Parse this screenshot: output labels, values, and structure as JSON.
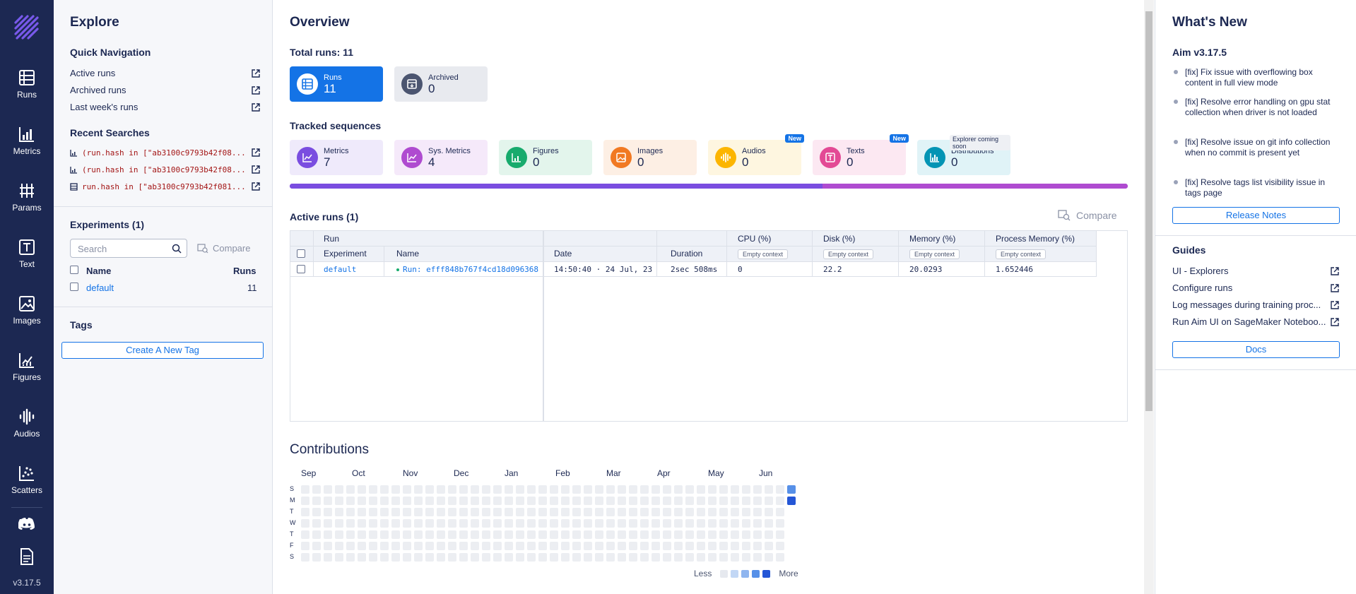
{
  "nav": {
    "items": [
      {
        "label": "Runs"
      },
      {
        "label": "Metrics"
      },
      {
        "label": "Params"
      },
      {
        "label": "Text"
      },
      {
        "label": "Images"
      },
      {
        "label": "Figures"
      },
      {
        "label": "Audios"
      },
      {
        "label": "Scatters"
      }
    ],
    "version": "v3.17.5"
  },
  "explore": {
    "title": "Explore",
    "quick_nav_title": "Quick Navigation",
    "quick_nav": [
      "Active runs",
      "Archived runs",
      "Last week's runs"
    ],
    "recent_title": "Recent Searches",
    "recent": [
      "(run.hash in [\"ab3100c9793b42f08...",
      "(run.hash in [\"ab3100c9793b42f08...",
      "run.hash in [\"ab3100c9793b42f081..."
    ],
    "experiments_title": "Experiments (1)",
    "search_placeholder": "Search",
    "compare": "Compare",
    "col_name": "Name",
    "col_runs": "Runs",
    "exp_name": "default",
    "exp_runs": "11",
    "tags_title": "Tags",
    "create_tag": "Create A New Tag"
  },
  "main": {
    "title": "Overview",
    "total_runs": "Total runs: 11",
    "run_cards": [
      {
        "label": "Runs",
        "value": "11"
      },
      {
        "label": "Archived",
        "value": "0"
      }
    ],
    "tracked_title": "Tracked sequences",
    "seq_cards": [
      {
        "label": "Metrics",
        "value": "7",
        "color": "#7a4de0"
      },
      {
        "label": "Sys. Metrics",
        "value": "4",
        "color": "#af4bd0"
      },
      {
        "label": "Figures",
        "value": "0",
        "color": "#18ab6d"
      },
      {
        "label": "Images",
        "value": "0",
        "color": "#f17922"
      },
      {
        "label": "Audios",
        "value": "0",
        "color": "#fcb500",
        "badge": "New"
      },
      {
        "label": "Texts",
        "value": "0",
        "color": "#e34a95",
        "badge": "New"
      },
      {
        "label": "Distributions",
        "value": "0",
        "color": "#0394b4",
        "badge": "Explorer coming soon"
      }
    ],
    "progress": {
      "metrics_fraction": 0.636,
      "metrics_color": "#7a4de0",
      "sys_color": "#af4bd0"
    },
    "active_runs_title": "Active runs (1)",
    "compare": "Compare",
    "table": {
      "group_run": "Run",
      "col_experiment": "Experiment",
      "col_name": "Name",
      "col_date": "Date",
      "col_duration": "Duration",
      "col_cpu": "CPU (%)",
      "col_disk": "Disk (%)",
      "col_memory": "Memory (%)",
      "col_pmem": "Process Memory (%)",
      "empty_context": "Empty context",
      "row": {
        "experiment": "default",
        "name": "Run: efff848b767f4cd18d096368",
        "date": "14:50:40 · 24 Jul, 23",
        "duration": "2sec 508ms",
        "cpu": "0",
        "disk": "22.2",
        "memory": "20.0293",
        "pmem": "1.652446"
      }
    },
    "contributions_title": "Contributions",
    "months": [
      "Sep",
      "Oct",
      "Nov",
      "Dec",
      "Jan",
      "Feb",
      "Mar",
      "Apr",
      "May",
      "Jun"
    ],
    "days": [
      "S",
      "M",
      "T",
      "W",
      "T",
      "F",
      "S"
    ],
    "legend_less": "Less",
    "legend_more": "More",
    "legend_colors": [
      "#e6e9ef",
      "#c2d7f5",
      "#8fb5ef",
      "#5790e8",
      "#2456d6"
    ]
  },
  "whats_new": {
    "title": "What's New",
    "version": "Aim v3.17.5",
    "items": [
      "[fix] Fix issue with overflowing box content in full view mode",
      "[fix] Resolve error handling on gpu stat collection when driver is not loaded",
      "[fix] Resolve issue on git info collection when no commit is present yet",
      "[fix] Resolve tags list visibility issue in tags page"
    ],
    "release_notes": "Release Notes",
    "guides_title": "Guides",
    "guides": [
      "UI - Explorers",
      "Configure runs",
      "Log messages during training proc...",
      "Run Aim UI on SageMaker Noteboo..."
    ],
    "docs": "Docs"
  }
}
